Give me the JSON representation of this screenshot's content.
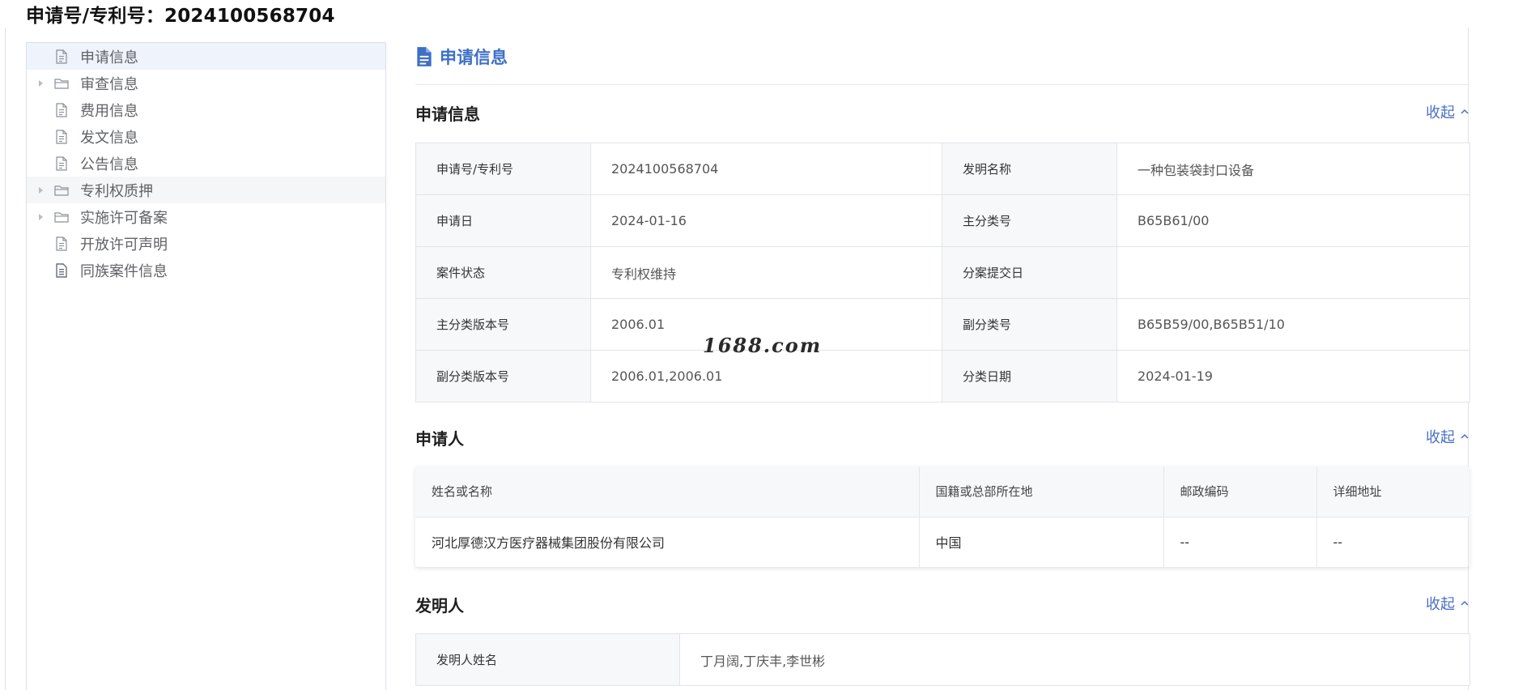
{
  "header": {
    "title": "申请号/专利号：2024100568704"
  },
  "sidebar": {
    "items": [
      {
        "label": "申请信息",
        "icon": "document-icon",
        "expandable": false,
        "state": "active"
      },
      {
        "label": "审查信息",
        "icon": "folder-icon",
        "expandable": true,
        "state": ""
      },
      {
        "label": "费用信息",
        "icon": "document-icon",
        "expandable": false,
        "state": ""
      },
      {
        "label": "发文信息",
        "icon": "document-icon",
        "expandable": false,
        "state": ""
      },
      {
        "label": "公告信息",
        "icon": "document-icon",
        "expandable": false,
        "state": ""
      },
      {
        "label": "专利权质押",
        "icon": "folder-icon",
        "expandable": true,
        "state": "hover"
      },
      {
        "label": "实施许可备案",
        "icon": "folder-icon",
        "expandable": true,
        "state": ""
      },
      {
        "label": "开放许可声明",
        "icon": "document-icon",
        "expandable": false,
        "state": ""
      },
      {
        "label": "同族案件信息",
        "icon": "document-filled-icon",
        "expandable": false,
        "state": ""
      }
    ]
  },
  "main": {
    "section_title": "申请信息",
    "collapse_label": "收起",
    "application_info": {
      "title": "申请信息",
      "rows": [
        [
          {
            "k": "申请号/专利号",
            "v": "2024100568704"
          },
          {
            "k": "发明名称",
            "v": "一种包装袋封口设备"
          }
        ],
        [
          {
            "k": "申请日",
            "v": "2024-01-16"
          },
          {
            "k": "主分类号",
            "v": "B65B61/00"
          }
        ],
        [
          {
            "k": "案件状态",
            "v": "专利权维持"
          },
          {
            "k": "分案提交日",
            "v": ""
          }
        ],
        [
          {
            "k": "主分类版本号",
            "v": "2006.01"
          },
          {
            "k": "副分类号",
            "v": "B65B59/00,B65B51/10"
          }
        ],
        [
          {
            "k": "副分类版本号",
            "v": "2006.01,2006.01"
          },
          {
            "k": "分类日期",
            "v": "2024-01-19"
          }
        ]
      ]
    },
    "applicant": {
      "title": "申请人",
      "columns": [
        "姓名或名称",
        "国籍或总部所在地",
        "邮政编码",
        "详细地址"
      ],
      "rows": [
        [
          "河北厚德汉方医疗器械集团股份有限公司",
          "中国",
          "--",
          "--"
        ]
      ]
    },
    "inventor": {
      "title": "发明人",
      "key": "发明人姓名",
      "value": "丁月阔,丁庆丰,李世彬"
    }
  },
  "watermark": "1688.com",
  "colors": {
    "accent": "#3d6fc6",
    "link": "#4a6fc9",
    "active_bg": "#eef3fc"
  }
}
